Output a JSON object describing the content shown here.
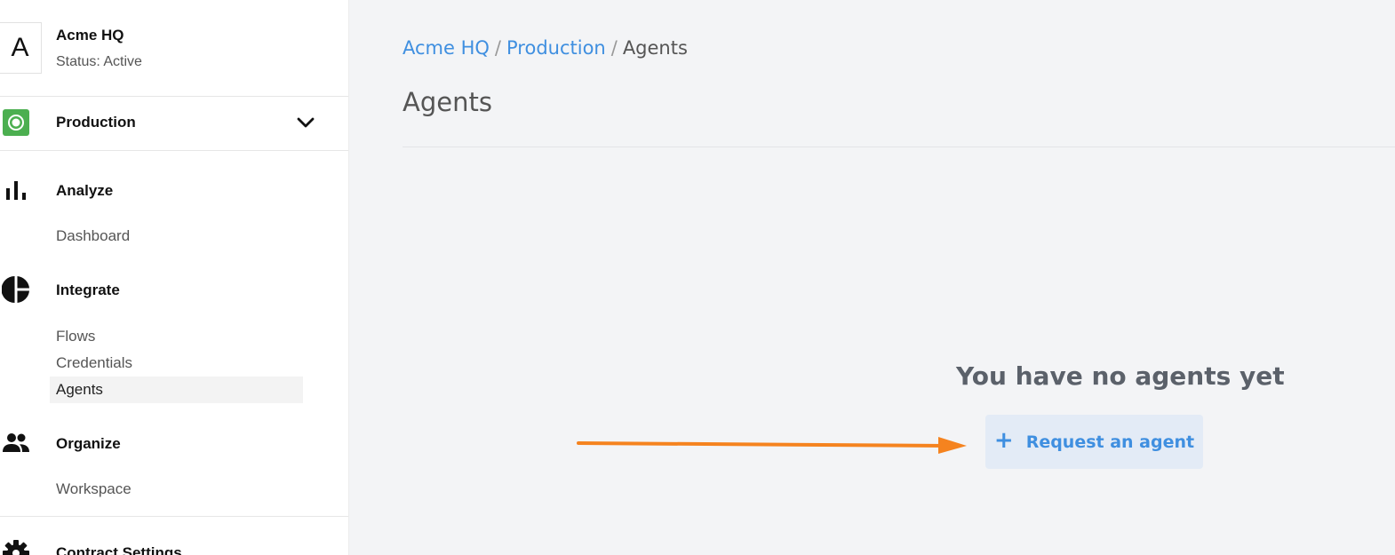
{
  "org": {
    "initial": "A",
    "name": "Acme HQ",
    "status": "Status: Active"
  },
  "environment": {
    "name": "Production",
    "icon": "radio-target-icon",
    "color": "#4caf50"
  },
  "sidebar": {
    "sections": [
      {
        "title": "Analyze",
        "icon": "bar-chart-icon",
        "items": [
          "Dashboard"
        ]
      },
      {
        "title": "Integrate",
        "icon": "pie-chart-icon",
        "items": [
          "Flows",
          "Credentials",
          "Agents"
        ]
      },
      {
        "title": "Organize",
        "icon": "people-icon",
        "items": [
          "Workspace"
        ]
      },
      {
        "title": "Contract Settings",
        "icon": "gear-icon",
        "items": []
      }
    ],
    "active_item": "Agents"
  },
  "breadcrumb": {
    "items": [
      "Acme HQ",
      "Production",
      "Agents"
    ],
    "separator": "/"
  },
  "page": {
    "title": "Agents",
    "empty_message": "You have no agents yet",
    "request_button": "Request an agent",
    "request_icon": "+"
  },
  "colors": {
    "link": "#3f8fe0",
    "annotation_arrow": "#f5831f",
    "button_bg": "#e3ebf6"
  }
}
